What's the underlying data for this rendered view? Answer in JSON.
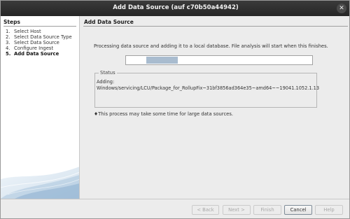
{
  "window": {
    "title": "Add Data Source (auf c70b50a44942)",
    "close_glyph": "✕"
  },
  "steps": {
    "heading": "Steps",
    "items": [
      {
        "num": "1.",
        "label": "Select Host"
      },
      {
        "num": "2.",
        "label": "Select Data Source Type"
      },
      {
        "num": "3.",
        "label": "Select Data Source"
      },
      {
        "num": "4.",
        "label": "Configure Ingest"
      },
      {
        "num": "5.",
        "label": "Add Data Source"
      }
    ]
  },
  "content": {
    "heading": "Add Data Source",
    "processing_text": "Processing data source and adding it to a local database. File analysis will start when this finishes.",
    "progress": {
      "start_fraction": 0.11,
      "end_fraction": 0.28
    },
    "status": {
      "legend": "Status",
      "line1": "Adding:",
      "line2": "Windows/servicing/LCU/Package_for_RollupFix~31bf3856ad364e35~amd64~~19041.1052.1.13"
    },
    "note": "♦This process may take some time for large data sources."
  },
  "footer": {
    "back": "< Back",
    "next": "Next >",
    "finish": "Finish",
    "cancel": "Cancel",
    "help": "Help"
  },
  "colors": {
    "progress_fill": "#a9bccf",
    "titlebar": "#2e2e2e"
  }
}
